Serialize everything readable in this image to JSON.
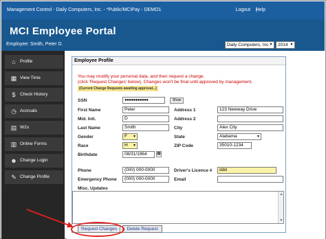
{
  "topbar": {
    "title": "Management Control - Daily Computers, Inc. - *Public/MCIPay - DEMO1",
    "logout": "Logout",
    "separator": "|",
    "help": "Help"
  },
  "header": {
    "title": "MCI Employee Portal"
  },
  "userbar": {
    "employee": "Employee: Smith, Peter D.",
    "company_select": "Daily Computers, Inc.",
    "year_select": "2014"
  },
  "sidebar": {
    "items": [
      {
        "label": "Profile",
        "icon": "home-icon"
      },
      {
        "label": "View Time",
        "icon": "calendar-icon"
      },
      {
        "label": "Check History",
        "icon": "money-bag-icon"
      },
      {
        "label": "Accruals",
        "icon": "clock-icon"
      },
      {
        "label": "W2s",
        "icon": "document-icon"
      },
      {
        "label": "Online Forms",
        "icon": "forms-icon"
      },
      {
        "label": "Change Login",
        "icon": "person-icon"
      },
      {
        "label": "Change Profile",
        "icon": "profile-edit-icon"
      }
    ]
  },
  "panel": {
    "title": "Employee Profile",
    "msg1": "You may modify your personal data, and then request a change.",
    "msg2": "(click 'Request Changes' below). Changes won't be final until approved by management.",
    "note": "(Current Change Requests awaiting approval...)"
  },
  "form": {
    "ssn_label": "SSN",
    "ssn_value": "●●●●●●●●●●●",
    "show_button": "Show",
    "first_name_label": "First Name",
    "first_name_value": "Peter",
    "mid_init_label": "Mid. Init.",
    "mid_init_value": "D",
    "last_name_label": "Last Name",
    "last_name_value": "Smith",
    "gender_label": "Gender",
    "gender_value": "F",
    "race_label": "Race",
    "race_value": "H",
    "birthdate_label": "Birthdate",
    "birthdate_value": "08/31/1964",
    "address1_label": "Address 1",
    "address1_value": "123 Newway Drive",
    "address2_label": "Address 2",
    "address2_value": "",
    "city_label": "City",
    "city_value": "Alex City",
    "state_label": "State",
    "state_value": "Alabama",
    "zip_label": "ZIP Code",
    "zip_value": "35010-1234",
    "phone_label": "Phone",
    "phone_value": "(000) 000-0000",
    "emergency_phone_label": "Emergency Phone",
    "emergency_phone_value": "(000) 000-0000",
    "drivers_licence_label": "Driver's Licence #",
    "drivers_licence_value": "ddd",
    "email_label": "Email",
    "email_value": "",
    "misc_label": "Misc. Updates"
  },
  "buttons": {
    "request_changes": "Request Changes",
    "delete_request": "Delete Request"
  },
  "colors": {
    "topbar": "#1c5fa0",
    "header": "#18588f",
    "sidebar": "#262626",
    "highlight_ring": "#e0201e",
    "message": "#cc0000"
  }
}
